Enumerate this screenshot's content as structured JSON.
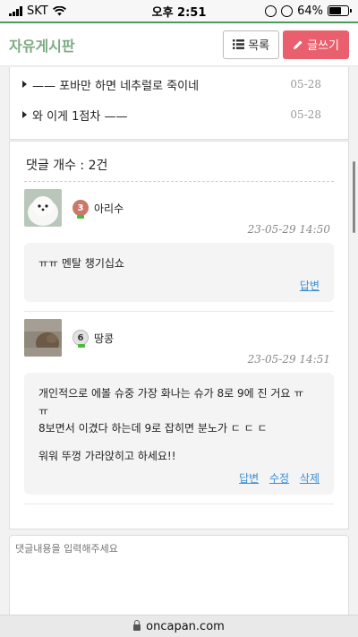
{
  "status_bar": {
    "carrier": "SKT",
    "time": "오후 2:51",
    "battery": "64%",
    "battery_level": 0.64
  },
  "header": {
    "title": "자유게시판",
    "list_button": "목록",
    "write_button": "글쓰기"
  },
  "related_posts": [
    {
      "title": "—— 포바만 하면 네추럴로 죽이네",
      "date": "05-28"
    },
    {
      "title": "와 이게 1점차 ——",
      "date": "05-28"
    }
  ],
  "comments_section": {
    "count_label": "댓글 개수 : 2건"
  },
  "comments": [
    {
      "level": "3",
      "nickname": "아리수",
      "date": "23-05-29 14:50",
      "lines": [
        "ㅠㅠ 멘탈 챙기십쇼"
      ],
      "actions": [
        "답변"
      ]
    },
    {
      "level": "6",
      "nickname": "땅콩",
      "date": "23-05-29 14:51",
      "lines": [
        "개인적으로 에볼 슈중 가장 화나는 슈가 8로 9에 진 거요 ㅠ",
        "ㅠ",
        "8보면서 이겼다 하는데 9로 잡히면 분노가 ㄷ ㄷ ㄷ",
        "",
        "워워 뚜껑 가라앉히고 하세요!!"
      ],
      "actions": [
        "답변",
        "수정",
        "삭제"
      ]
    }
  ],
  "reply": {
    "placeholder": "댓글내용을 입력해주세요"
  },
  "url_bar": {
    "domain": "oncapan.com"
  }
}
